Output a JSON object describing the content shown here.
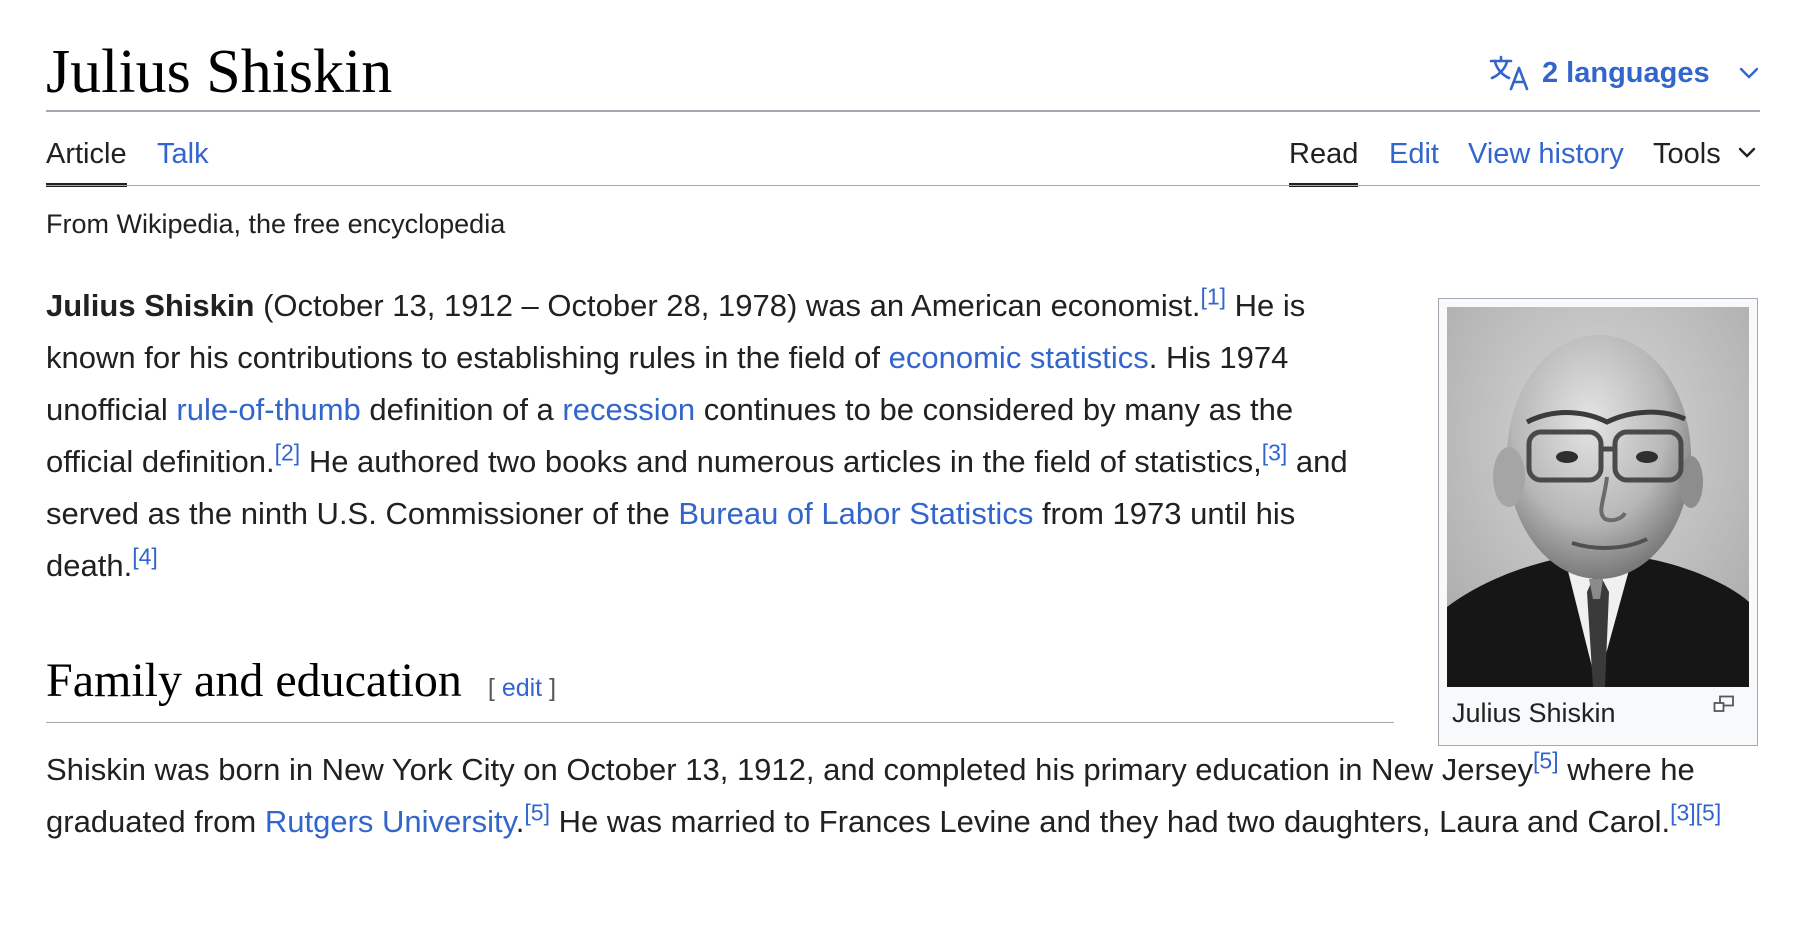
{
  "page": {
    "title": "Julius Shiskin",
    "tagline": "From Wikipedia, the free encyclopedia"
  },
  "languages": {
    "label": "2 languages",
    "icon": "translate-icon"
  },
  "tabs": {
    "article": "Article",
    "talk": "Talk"
  },
  "actions": {
    "read": "Read",
    "edit": "Edit",
    "history": "View history",
    "tools": "Tools"
  },
  "intro": {
    "name": "Julius Shiskin",
    "t1": " (October 13, 1912 – October 28, 1978) was an American economist.",
    "ref1": "[1]",
    "t2": " He is known for his contributions to establishing rules in the field of ",
    "link_econ": "economic statistics",
    "t3": ". His 1974 unofficial ",
    "link_rule": "rule-of-thumb",
    "t4": " definition of a ",
    "link_recession": "recession",
    "t5": " continues to be considered by many as the official definition.",
    "ref2": "[2]",
    "t6": " He authored two books and numerous articles in the field of statistics,",
    "ref3": "[3]",
    "t7": " and served as the ninth U.S. Commissioner of the ",
    "link_bls": "Bureau of Labor Statistics",
    "t8": " from 1973 until his death.",
    "ref4": "[4]"
  },
  "section": {
    "heading": "Family and education",
    "edit_open": "[ ",
    "edit_label": "edit",
    "edit_close": " ]"
  },
  "family": {
    "t1": "Shiskin was born in New York City on October 13, 1912, and completed his primary education in New Jersey",
    "ref5a": "[5]",
    "t2": " where he graduated from ",
    "link_rutgers": "Rutgers University",
    "t3": ".",
    "ref5b": "[5]",
    "t4": " He was married to Frances Levine and they had two daughters, Laura and Carol.",
    "ref3": "[3]",
    "ref5c": "[5]"
  },
  "infobox": {
    "caption": "Julius Shiskin"
  },
  "colors": {
    "link": "#3366cc",
    "text": "#202122",
    "rule": "#a2a9b1"
  }
}
